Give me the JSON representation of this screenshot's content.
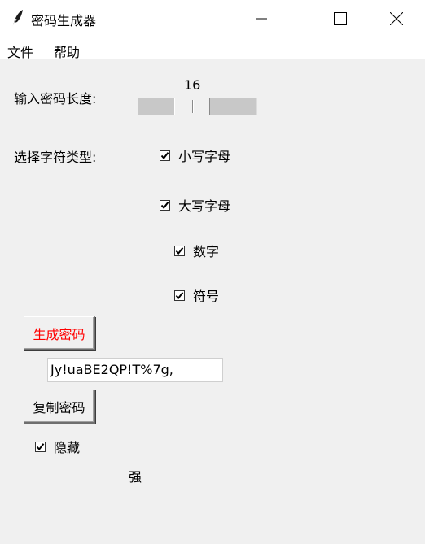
{
  "window": {
    "title": "密码生成器",
    "icon": "feather-icon"
  },
  "menu": {
    "file": "文件",
    "help": "帮助"
  },
  "length": {
    "label": "输入密码长度:",
    "value": "16"
  },
  "types": {
    "label": "选择字符类型:",
    "lowercase": {
      "label": "小写字母",
      "checked": true
    },
    "uppercase": {
      "label": "大写字母",
      "checked": true
    },
    "digits": {
      "label": "数字",
      "checked": true
    },
    "symbols": {
      "label": "符号",
      "checked": true
    }
  },
  "actions": {
    "generate_label": "生成密码",
    "generate_color": "#ff0000",
    "copy_label": "复制密码"
  },
  "password": {
    "value": "Jy!uaBE2QP!T%7g,"
  },
  "hide": {
    "label": "隐藏",
    "checked": true
  },
  "strength": {
    "text": "强"
  }
}
